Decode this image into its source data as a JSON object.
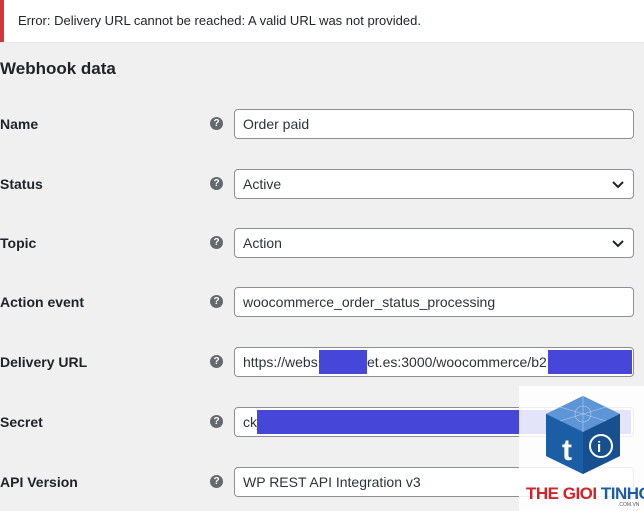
{
  "notice": {
    "message": "Error: Delivery URL cannot be reached: A valid URL was not provided."
  },
  "section": {
    "title": "Webhook data"
  },
  "form": {
    "name": {
      "label": "Name",
      "value": "Order paid"
    },
    "status": {
      "label": "Status",
      "value": "Active"
    },
    "topic": {
      "label": "Topic",
      "value": "Action"
    },
    "action_event": {
      "label": "Action event",
      "value": "woocommerce_order_status_processing"
    },
    "delivery_url": {
      "label": "Delivery URL",
      "value_start": "https://webs",
      "value_mid": "et.es:3000/woocommerce/b2"
    },
    "secret": {
      "label": "Secret",
      "value_start": "ck_"
    },
    "api_version": {
      "label": "API Version",
      "value": "WP REST API Integration v3"
    },
    "help_glyph": "?"
  },
  "watermark": {
    "brand_part1": "THE GIOI",
    "brand_part2": "TINHOC",
    "domain": ".COM.VN",
    "colors": {
      "red": "#d2232a",
      "blue": "#1b5ea6"
    }
  },
  "icons": {
    "help": "help-circle-icon",
    "dropdown": "chevron-down-icon",
    "logo": "thegioitinhoc-logo-icon"
  },
  "colors": {
    "error_border": "#d63638",
    "redaction": "#4646d8",
    "background": "#f0f0f1"
  }
}
